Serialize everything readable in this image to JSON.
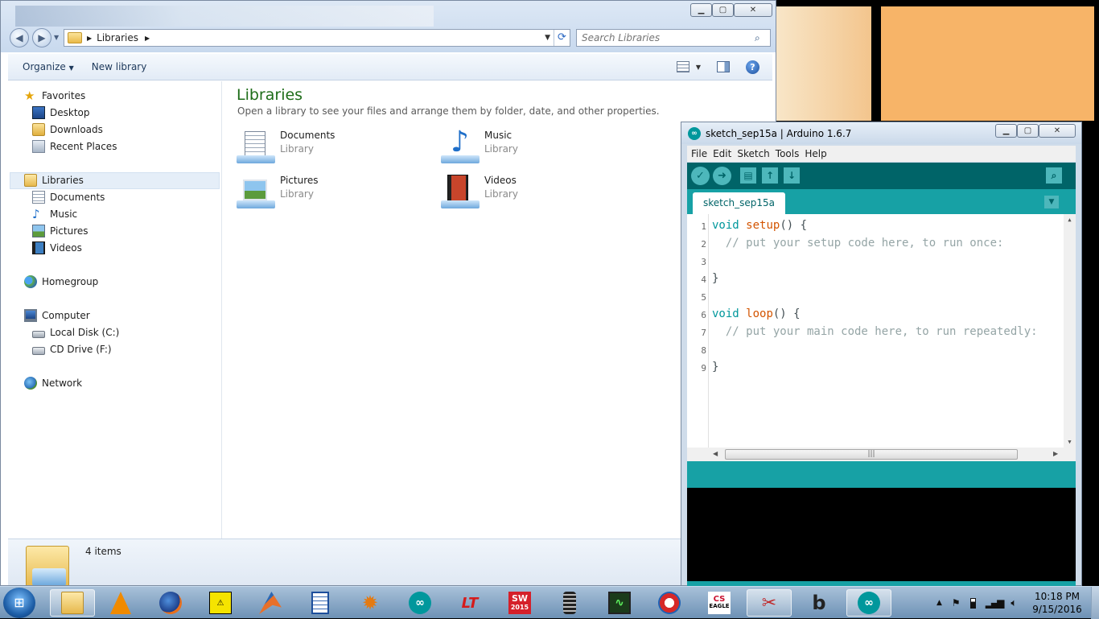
{
  "explorer": {
    "address": {
      "crumb": "Libraries"
    },
    "search": {
      "placeholder": "Search Libraries"
    },
    "toolbar": {
      "organize": "Organize",
      "new_library": "New library"
    },
    "nav": {
      "favorites": "Favorites",
      "desktop": "Desktop",
      "downloads": "Downloads",
      "recent": "Recent Places",
      "libraries": "Libraries",
      "documents": "Documents",
      "music": "Music",
      "pictures": "Pictures",
      "videos": "Videos",
      "homegroup": "Homegroup",
      "computer": "Computer",
      "local_disk": "Local Disk (C:)",
      "cd_drive": "CD Drive (F:)",
      "network": "Network"
    },
    "content": {
      "title": "Libraries",
      "subtitle": "Open a library to see your files and arrange them by folder, date, and other properties.",
      "items": [
        {
          "name": "Documents",
          "type": "Library"
        },
        {
          "name": "Music",
          "type": "Library"
        },
        {
          "name": "Pictures",
          "type": "Library"
        },
        {
          "name": "Videos",
          "type": "Library"
        }
      ]
    },
    "status": {
      "count": "4 items"
    }
  },
  "arduino": {
    "title": "sketch_sep15a | Arduino 1.6.7",
    "menu": {
      "file": "File",
      "edit": "Edit",
      "sketch": "Sketch",
      "tools": "Tools",
      "help": "Help"
    },
    "tab": "sketch_sep15a",
    "lines": [
      "1",
      "2",
      "3",
      "4",
      "5",
      "6",
      "7",
      "8",
      "9"
    ],
    "code": {
      "l1a": "void",
      "l1b": "setup",
      "l1c": "() {",
      "l2": "// put your setup code here, to run once:",
      "l4": "}",
      "l6a": "void",
      "l6b": "loop",
      "l6c": "() {",
      "l7": "// put your main code here, to run repeatedly:",
      "l9": "}"
    },
    "colors": {
      "teal_dark": "#006468",
      "teal": "#17a1a5",
      "keyword": "#00979c",
      "function": "#d35400",
      "comment": "#95a5a6"
    }
  },
  "taskbar": {
    "icons": [
      "start-orb",
      "windows-explorer",
      "vlc",
      "firefox",
      "electrical-hazard-app",
      "matlab",
      "libreoffice-writer",
      "burst-app",
      "arduino",
      "ltspice",
      "solidworks-2015",
      "coil-app",
      "oscilloscope-app",
      "ccleaner",
      "eagle",
      "snipping-tool",
      "b-app",
      "arduino-active"
    ],
    "sw_label": "2015",
    "eagle_label": "EAGLE",
    "time": "10:18 PM",
    "date": "9/15/2016"
  }
}
